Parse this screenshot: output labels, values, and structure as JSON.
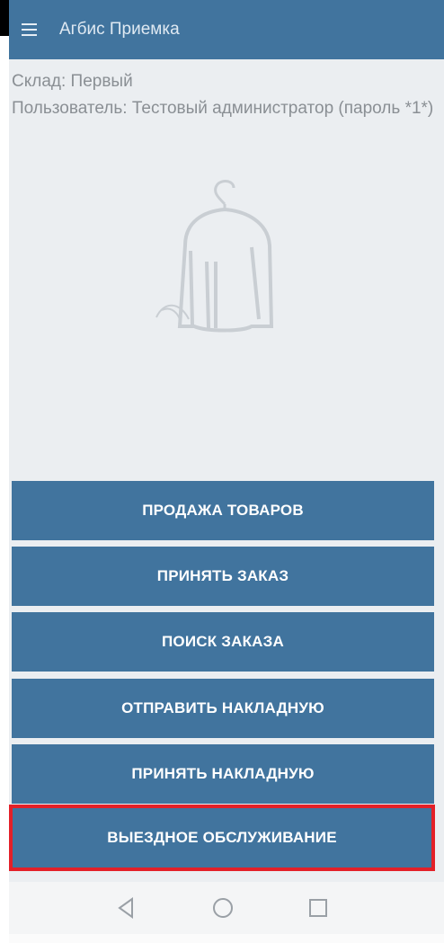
{
  "app": {
    "title": "Агбис Приемка"
  },
  "info": {
    "warehouse": "Склад: Первый",
    "user": "Пользователь: Тестовый администратор (пароль *1*)"
  },
  "buttons": {
    "sale": "ПРОДАЖА ТОВАРОВ",
    "accept_order": "ПРИНЯТЬ ЗАКАЗ",
    "search_order": "ПОИСК ЗАКАЗА",
    "send_invoice": "ОТПРАВИТЬ НАКЛАДНУЮ",
    "receive_invoice": "ПРИНЯТЬ НАКЛАДНУЮ",
    "field_service": "ВЫЕЗДНОЕ ОБСЛУЖИВАНИЕ"
  },
  "icons": {
    "menu": "hamburger-menu-icon",
    "illustration": "garment-on-hanger-icon",
    "back": "back-triangle-icon",
    "home": "home-circle-icon",
    "recent": "recent-apps-square-icon"
  },
  "colors": {
    "primary": "#41749e",
    "background": "#ebeef1",
    "highlight": "#e32028"
  }
}
